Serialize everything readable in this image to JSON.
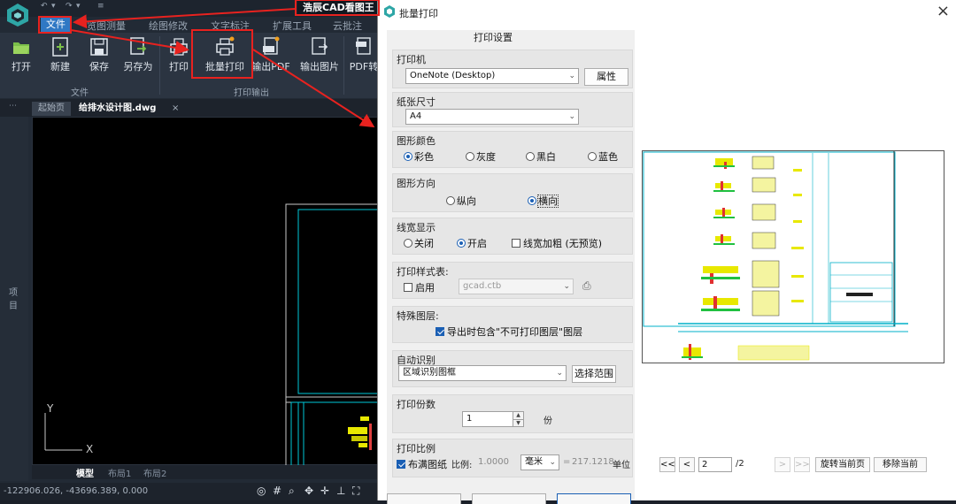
{
  "cad": {
    "app_title": "浩辰CAD看图王",
    "menus": [
      "文件",
      "览图测量",
      "绘图修改",
      "文字标注",
      "扩展工具",
      "云批注"
    ],
    "ribbon": {
      "items": [
        {
          "label": "打开",
          "icon": "folder-open-icon"
        },
        {
          "label": "新建",
          "icon": "new-file-icon"
        },
        {
          "label": "保存",
          "icon": "save-icon"
        },
        {
          "label": "另存为",
          "icon": "save-as-icon"
        },
        {
          "label": "打印",
          "icon": "printer-icon"
        },
        {
          "label": "批量打印",
          "icon": "batch-print-icon"
        },
        {
          "label": "输出PDF",
          "icon": "pdf-export-icon"
        },
        {
          "label": "输出图片",
          "icon": "image-export-icon"
        },
        {
          "label": "PDF转",
          "icon": "pdf-convert-icon"
        }
      ],
      "groups": [
        "文件",
        "打印输出"
      ]
    },
    "doc_tabs": [
      "起始页",
      "给排水设计图.dwg"
    ],
    "side_label": "项目",
    "layout_tabs": [
      "模型",
      "布局1",
      "布局2"
    ],
    "axis": {
      "y": "Y",
      "x": "X"
    },
    "coords": "-122906.026, -43696.389, 0.000",
    "colors": {
      "accent": "#2f78c4",
      "highlight": "#e8221f"
    }
  },
  "dialog": {
    "title": "批量打印",
    "settings_title": "打印设置",
    "printer": {
      "label": "打印机",
      "value": "OneNote (Desktop)",
      "props_button": "属性"
    },
    "paper": {
      "label": "纸张尺寸",
      "value": "A4"
    },
    "color": {
      "label": "图形颜色",
      "options": [
        "彩色",
        "灰度",
        "黑白",
        "蓝色"
      ],
      "selected": "彩色"
    },
    "orientation": {
      "label": "图形方向",
      "options": [
        "纵向",
        "横向"
      ],
      "selected": "横向"
    },
    "lineweight": {
      "label": "线宽显示",
      "options": [
        "关闭",
        "开启"
      ],
      "selected": "开启",
      "bold_check": "线宽加粗 (无预览)"
    },
    "style_table": {
      "label": "打印样式表:",
      "enable": "启用",
      "value": "gcad.ctb"
    },
    "special_layer": {
      "label": "特殊图层:",
      "check": "导出时包含\"不可打印图层\"图层"
    },
    "auto_detect": {
      "label": "自动识别",
      "value": "区域识别图框",
      "range_button": "选择范围"
    },
    "copies": {
      "label": "打印份数",
      "value": "1",
      "unit": "份"
    },
    "scale": {
      "label": "打印比例",
      "fill_check": "布满图纸",
      "ratio_label": "比例:",
      "ratio_value": "1.0000",
      "unit_value": "毫米",
      "equals": "=",
      "result": "217.1218",
      "unit_label": "单位"
    },
    "nav": {
      "first": "<<",
      "prev": "<",
      "page": "2",
      "total": "/2",
      "next": ">",
      "last": ">>",
      "rotate": "旋转当前页",
      "remove": "移除当前"
    }
  }
}
